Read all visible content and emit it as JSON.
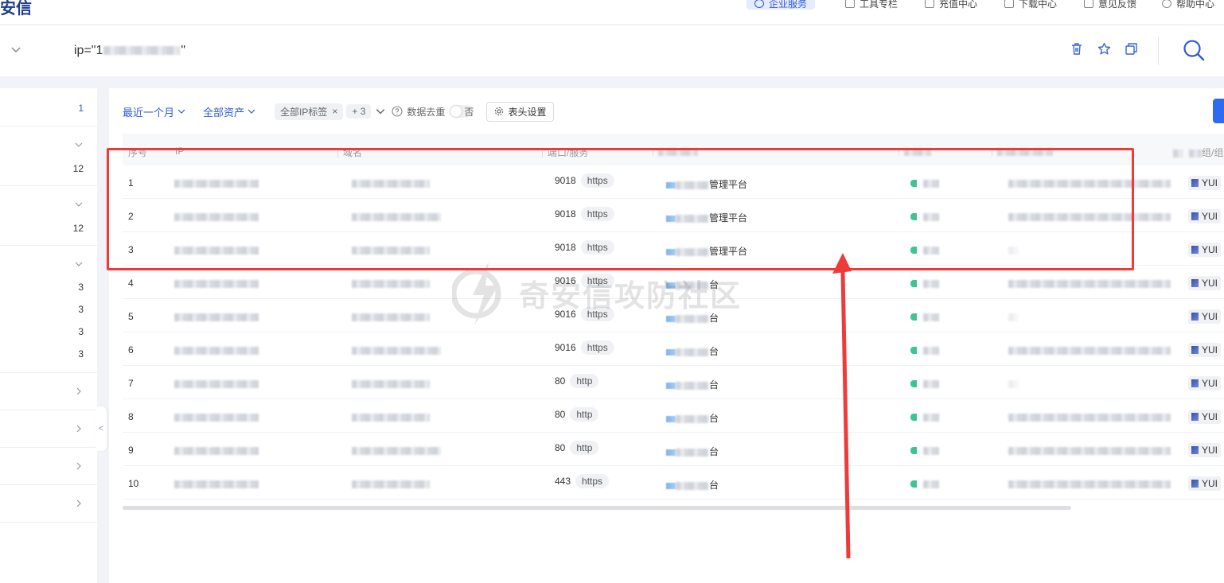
{
  "brand": {
    "logo_text": "安信"
  },
  "nav": [
    {
      "label": "企业服务",
      "icon": "user-icon",
      "active": true
    },
    {
      "label": "工具专栏",
      "icon": "toolbox-icon",
      "active": false
    },
    {
      "label": "充值中心",
      "icon": "wallet-icon",
      "active": false
    },
    {
      "label": "下载中心",
      "icon": "download-icon",
      "active": false
    },
    {
      "label": "意见反馈",
      "icon": "feedback-icon",
      "active": false
    },
    {
      "label": "帮助中心",
      "icon": "help-icon",
      "active": false
    }
  ],
  "search": {
    "query_prefix": "ip=\"1",
    "query_suffix": "\""
  },
  "sidebar": {
    "counts": [
      "1",
      "12",
      "12",
      "3",
      "3",
      "3",
      "3"
    ]
  },
  "filters": {
    "time": "最近一个月",
    "assets": "全部资产",
    "tag_chip": "全部IP标签",
    "more_chip": "+ 3",
    "dedupe_label": "数据去重",
    "dedupe_value": "否",
    "header_settings": "表头设置"
  },
  "table": {
    "headers": {
      "index": "序号",
      "ip": "IP",
      "domain": "域名",
      "port": "端口/服务",
      "component": "组/组件"
    },
    "rows": [
      {
        "index": "1",
        "port": "9018",
        "service": "https",
        "product_suffix": "管理平台",
        "component": "YUI"
      },
      {
        "index": "2",
        "port": "9018",
        "service": "https",
        "product_suffix": "管理平台",
        "component": "YUI"
      },
      {
        "index": "3",
        "port": "9018",
        "service": "https",
        "product_suffix": "管理平台",
        "component": "YUI"
      },
      {
        "index": "4",
        "port": "9016",
        "service": "https",
        "product_suffix": "台",
        "component": "YUI"
      },
      {
        "index": "5",
        "port": "9016",
        "service": "https",
        "product_suffix": "台",
        "component": "YUI"
      },
      {
        "index": "6",
        "port": "9016",
        "service": "https",
        "product_suffix": "台",
        "component": "YUI"
      },
      {
        "index": "7",
        "port": "80",
        "service": "http",
        "product_suffix": "台",
        "component": "YUI"
      },
      {
        "index": "8",
        "port": "80",
        "service": "http",
        "product_suffix": "台",
        "component": "YUI"
      },
      {
        "index": "9",
        "port": "80",
        "service": "http",
        "product_suffix": "台",
        "component": "YUI"
      },
      {
        "index": "10",
        "port": "443",
        "service": "https",
        "product_suffix": "台",
        "component": "YUI"
      }
    ]
  },
  "watermark": {
    "text": "奇安信攻防社区"
  },
  "colors": {
    "accent": "#2f5bd5",
    "annotation": "#f03a3a",
    "status_green": "#3cc497"
  }
}
